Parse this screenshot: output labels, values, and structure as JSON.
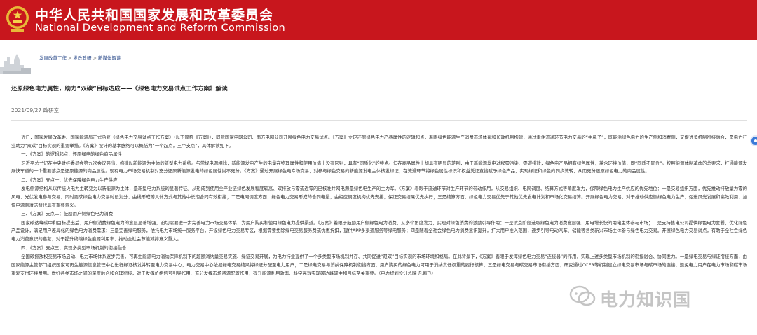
{
  "header": {
    "cn_title": "中华人民共和国国家发展和改革委员会",
    "en_title": "National Development and Reform Commission"
  },
  "breadcrumb": [
    "发展改革工作",
    "发改政研",
    "新媒体解读"
  ],
  "article": {
    "title": "还原绿色电力属性，助力“双碳”目标达成——《绿色电力交易试点工作方案》解读",
    "meta": "2021/09/27 政研室",
    "paragraphs": [
      "近日，国家发展改革委、国家能源局正式函复《绿色电力交易试点工作方案》（以下简称《方案》），同意国家电网公司、南方电网公司开展绿色电力交易试点。《方案》立足还原绿色电力产品属性的逻辑起点，着眼绿色能源生产消费市场体系和长效机制构建，通过幸住流通环节电力交易的“牛鼻子”，既能活绿色电力的生产侧和消费侧，又促进多机制衔接融合，是电力行业助力“双碳”目标实现的重要举措。《方案》设计的基本脉络可以概括为“一个起点，三个支点”，具体解读如下。",
      "一、《方案》的逻辑起点：还原绿电的绿色商品属性",
      "习近平总书记在中央财经委员会第九次会议强出，构建以新能源为主体的新型电力系统。与常规电源相比，新能源发电产生的电量在物理属性和使用价值上没有区别，具有“同质化”的特点。但在商品属性上却具有明显的差别，由于新能源发电过程零污染、零碳排放，绿色电产品拥有绿色属性，蕴含环境价值，即“同质不同价”。按照能源体制革命的总要求，打通能源发展快车道的一个重要落点是还原能源的商品属性。现有电力市场交易机制对充分还原新能源发电的绿色属性尚不充分。《方案》通过开展绿色电专场交易，对参与绿色交易的新能源发电主体核发绿证，在流通环节将绿色属性标识和权益凭证直接赋予绿色产品，实现绿证和绿色的同步流转，从而充分还原绿色电力的商品属性。",
      "二、《方案》支点一：优先保障绿色电力生产供应",
      "发电侧源结构从以传统火电为主转变为以新能源为主体，是新型电力系统的显著特征。从形成到使用全产业链绿色发展程度较高、碳排放与零或近零的已核准并网电源是绿色电生产的主力军。《方案》着眼于流通环节对生产环节的带动作用，从交易组织、电网调度、结算方式等角度发力，保障绿色电力生产供应的优先地位：一是交易组织方面，优先推动排放量为零的风电、光伏发电参与交易，同时要求绿色电力交易时段划分、曲线形成等具体方式与其他中长期合同有效衔接；二是电网调度方面，绿色电力交易形成的合同电量，由相应调度机构优先安排，保证交易结果优先执行；三是结算方面，绿色电力交易优先于其他优先发电计划和市场化交易结算。开展绿色电力交易，对于推动供应侧绿色电力生产，促进风光发展和高效利用，加快电源侧清洁替代具有重要意义。",
      "三、《方案》支点二：鼓励用户侧绿色电力消费",
      "国家碳达峰碳中和目标提出后，用户侧消费绿色电力的意愿显著增强，迫切需要进一步完善电力市场交易体系，为用户购买和使用绿色电力提供渠道。《方案》着眼于鼓励用户侧绿色电力消费，从多个角度发力，实现对绿色消费的激励引导作用：一是试点阶段选取绿色电力消费意愿强、用电增长快的用电主体参与市场；二是支持售电公司提供绿色电力套餐，优化绿色产品设计，满足用户差异化的绿色电力消费需求；三是完善绿电服务，依托电力市场统一服务平台，开设绿色电力交易专区，根据需要免除绿电交易服务费或优惠折扣，提供APP多渠道服务等绿电服务；四是随着全社会绿色电力消费意识提升，扩大用户准入范围，逐步引导电动汽车、储能等各类新兴市场主体参与绿色电力交易。开展绿色电力交易试点，有助于全社会绿色电力消费意识的启蒙，对于提升终端绿色能源利用率、推动全社会节能减排意义重大。",
      "四、《方案》支点三：实现多类型市场机制的衔接融合",
      "全国碳排放权交易市场启动、电力市场体系逐步完善，可再生能源电力消纳保障机制下的超额消纳量交易实施、绿证交易开展，为电力行业提供了一个多类型市场机制并存、共同促进“双碳”目标实现的市场环境和格局。在此背景下，《方案》着眼于发挥绿色电力交易“连接器”的作用，实现上述多类型市场机制的衔接融合、协同发力。一是绿电交易与绿证衔接方面，由国家能源主管部门组织国家可再生能源信息管理中心进行绿证核发并转至电力交易中心，电力交易中心依据绿电交易结果将绿证分配至电力用户；二是绿电交易与消纳保障机制衔接方面，用户购买的绿色电力可用于消纳责任权重的履行核算；三是绿电交易与碳交易市场衔接方面，研究通过CCER等机制建立绿电交易市场与碳市场的连接，避免电力用户在电力市场和碳市场重复支付环境费用。做好各类市场之间的深度融合和合理衔接，对于发挥价格信号引导作用、充分发挥市场资源配置作用，提升能源利用效率、科学高效实现碳达峰碳中和目标至关重要。（电力规划设计总院  凡鹏飞）"
    ]
  },
  "watermark": {
    "text": "电力知识国"
  },
  "icons": [
    "national-emblem-icon",
    "skyline-icon",
    "chat-bubble-icon"
  ],
  "colors": {
    "banner": "#c8161d",
    "link": "#2a4a8a",
    "side_button": "#3b7ad8"
  }
}
